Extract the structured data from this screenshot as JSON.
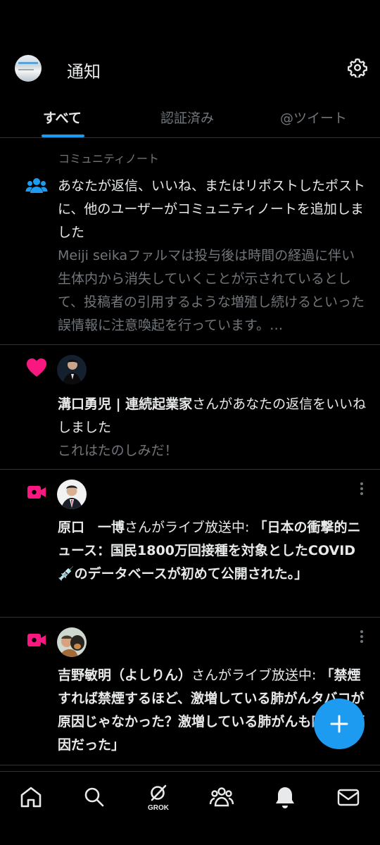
{
  "header": {
    "title": "通知"
  },
  "tabs": [
    {
      "label": "すべて",
      "active": true
    },
    {
      "label": "認証済み",
      "active": false
    },
    {
      "label": "@ツイート",
      "active": false
    }
  ],
  "notifications": [
    {
      "type": "community-note",
      "category": "コミュニティノート",
      "message": "あなたが返信、いいね、またはリポストしたポストに、他のユーザーがコミュニティノートを追加しました",
      "preview": "Meiji seikaファルマは投与後は時間の経過に伴い生体内から消失していくことが示されているとして、投稿者の引用するような増殖し続けるといった誤情報に注意喚起を行っています。…"
    },
    {
      "type": "like",
      "user": "溝口勇児 | 連続起業家",
      "action": "さんがあなたの返信をいいねしました",
      "preview": "これはたのしみだ！"
    },
    {
      "type": "live",
      "user": "原口　一博",
      "action": "さんがライブ放送中: ",
      "title": "「日本の衝撃的ニュース：国民1800万回接種を対象としたCOVID💉のデータベースが初めて公開された。」"
    },
    {
      "type": "live",
      "user": "吉野敏明（よしりん）",
      "action": "さんがライブ放送中: ",
      "title": "「禁煙すれば禁煙するほど、激増している肺がんタバコが原因じゃなかった？激増している肺がんも四毒が原因だった」"
    }
  ],
  "bottom_nav": [
    {
      "name": "home-icon"
    },
    {
      "name": "search-icon"
    },
    {
      "name": "grok-icon",
      "label": "GROK"
    },
    {
      "name": "communities-icon"
    },
    {
      "name": "notifications-icon"
    },
    {
      "name": "messages-icon"
    }
  ],
  "colors": {
    "accent": "#1d9bf0",
    "like": "#f91880",
    "live": "#f91880",
    "muted": "#71767b",
    "divider": "#2f3336"
  }
}
